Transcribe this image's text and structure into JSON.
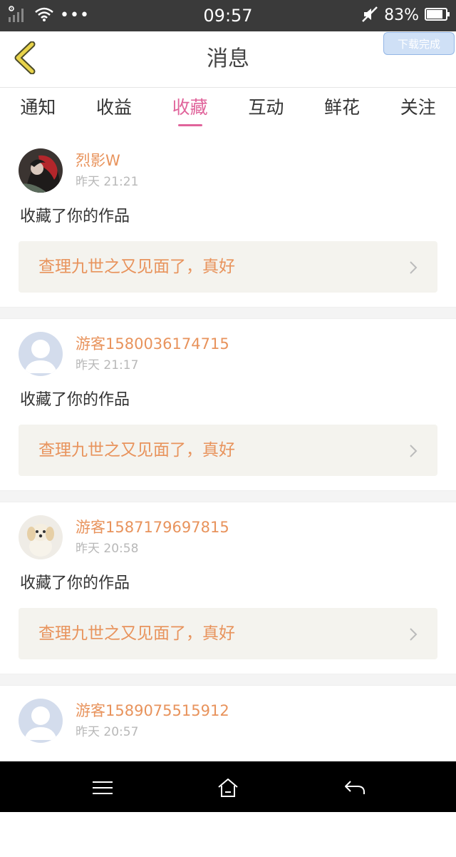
{
  "status_bar": {
    "time": "09:57",
    "battery_percent": "83%",
    "battery_level": 0.83,
    "icons": [
      "signal-icon",
      "wifi-icon",
      "more-dots-icon",
      "mute-icon",
      "battery-icon"
    ]
  },
  "header": {
    "title": "消息",
    "toast": "下载完成",
    "back_icon": "back-chevron-icon"
  },
  "tabs": [
    {
      "label": "通知",
      "active": false
    },
    {
      "label": "收益",
      "active": false
    },
    {
      "label": "收藏",
      "active": true
    },
    {
      "label": "互动",
      "active": false
    },
    {
      "label": "鲜花",
      "active": false
    },
    {
      "label": "关注",
      "active": false
    }
  ],
  "feed": [
    {
      "username": "烈影W",
      "time": "昨天 21:21",
      "action": "收藏了你的作品",
      "work_title": "查理九世之又见面了，真好",
      "avatar": "anime-avatar"
    },
    {
      "username": "游客1580036174715",
      "time": "昨天 21:17",
      "action": "收藏了你的作品",
      "work_title": "查理九世之又见面了，真好",
      "avatar": "default-avatar"
    },
    {
      "username": "游客1587179697815",
      "time": "昨天 20:58",
      "action": "收藏了你的作品",
      "work_title": "查理九世之又见面了，真好",
      "avatar": "puppy-avatar"
    },
    {
      "username": "游客1589075515912",
      "time": "昨天 20:57",
      "action": "",
      "work_title": "",
      "avatar": "default-avatar"
    }
  ],
  "nav_bar": {
    "icons": [
      "menu-icon",
      "home-icon",
      "back-arrow-icon"
    ]
  },
  "colors": {
    "accent": "#e0649b",
    "username": "#e8935c",
    "card_link_bg": "#f4f3ee",
    "status_bar_bg": "#3a3a3a"
  }
}
